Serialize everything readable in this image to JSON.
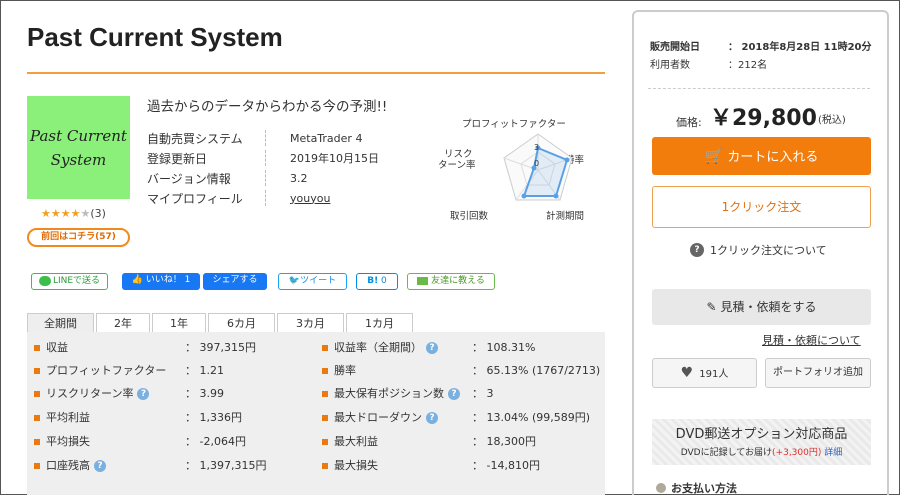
{
  "product": {
    "title": "Past Current System",
    "thumb_line1": "Past Current",
    "thumb_line2": "System",
    "review_count": "(3)",
    "rating": 4,
    "rating_max": 5,
    "prev_button": "前回はコチラ(57)",
    "tagline": "過去からのデータからわかる今の予測!!",
    "info": [
      {
        "key": "自動売買システム",
        "value": "MetaTrader 4"
      },
      {
        "key": "登録更新日",
        "value": "2019年10月15日"
      },
      {
        "key": "バージョン情報",
        "value": "3.2"
      },
      {
        "key": "マイプロフィール",
        "value": "youyou"
      }
    ]
  },
  "radar": {
    "labels": {
      "top": "プロフィットファクター",
      "right": "勝率",
      "bottom_right": "計測期間",
      "bottom_left": "取引回数",
      "left1": "リスク",
      "left2": "ターン率"
    },
    "scale_labels": [
      "3",
      "0"
    ]
  },
  "social": {
    "line": "LINEで送る",
    "like": "いいね！",
    "like_count": "1",
    "share": "シェアする",
    "tweet": "ツイート",
    "hatena": "B!",
    "hatena_count": "0",
    "mail": "友達に教える"
  },
  "tabs": [
    "全期間",
    "2年",
    "1年",
    "6カ月",
    "3カ月",
    "1カ月"
  ],
  "stats": {
    "left": [
      {
        "label": "収益",
        "value": "397,315円",
        "help": false
      },
      {
        "label": "プロフィットファクター",
        "value": "1.21",
        "help": false
      },
      {
        "label": "リスクリターン率",
        "value": "3.99",
        "help": true
      },
      {
        "label": "平均利益",
        "value": "1,336円",
        "help": false
      },
      {
        "label": "平均損失",
        "value": "-2,064円",
        "help": false
      },
      {
        "label": "口座残高",
        "value": "1,397,315円",
        "help": true
      }
    ],
    "right": [
      {
        "label": "収益率（全期間）",
        "value": "108.31%",
        "help": true
      },
      {
        "label": "勝率",
        "value": "65.13% (1767/2713)",
        "help": false
      },
      {
        "label": "最大保有ポジション数",
        "value": "3",
        "help": true
      },
      {
        "label": "最大ドローダウン",
        "value": "13.04% (99,589円)",
        "help": true
      },
      {
        "label": "最大利益",
        "value": "18,300円",
        "help": false
      },
      {
        "label": "最大損失",
        "value": "-14,810円",
        "help": false
      }
    ]
  },
  "sidebar": {
    "sale_start_label": "販売開始日",
    "sale_start_value": "：  2018年8月28日 11時20分",
    "users_label": "利用者数",
    "users_value": "：212名",
    "price_label": "価格:",
    "price": "￥29,800",
    "price_tax": "(税込)",
    "cart_button": "カートに入れる",
    "oneclick_button": "1クリック注文",
    "oneclick_about": "1クリック注文について",
    "quote_button": "見積・依頼をする",
    "quote_link": "見積・依頼について",
    "fav_count": "191人",
    "portfolio_button": "ポートフォリオ追加",
    "dvd_title": "DVD郵送オプション対応商品",
    "dvd_sub": "DVDに記録してお届け",
    "dvd_price": "(+3,300円)",
    "dvd_detail": "詳細",
    "payment": "お支払い方法"
  },
  "colors": {
    "accent": "#f27d0c",
    "thumb_bg": "#8af07a",
    "stats_bg": "#efefef"
  }
}
